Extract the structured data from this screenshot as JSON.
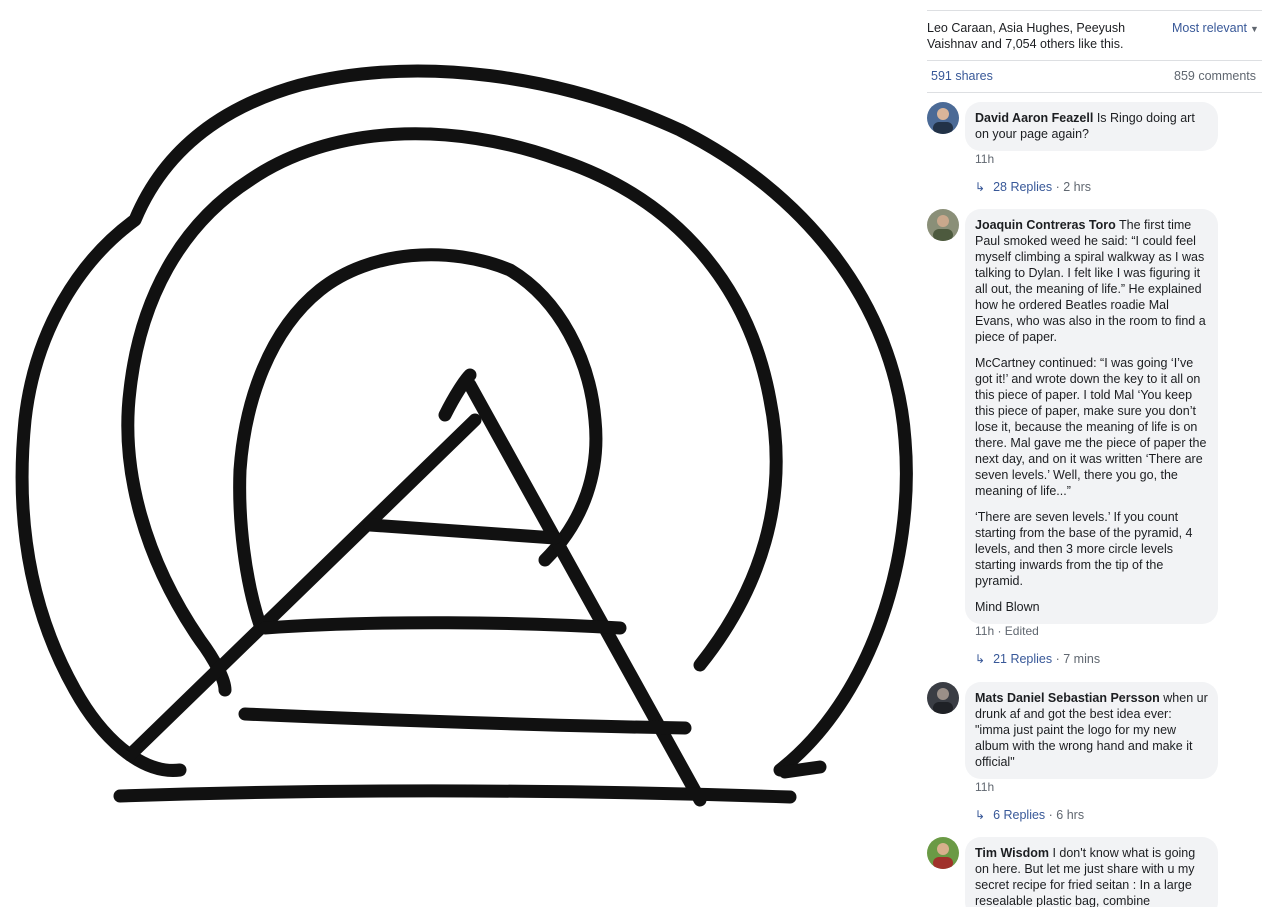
{
  "post": {
    "likes_text": "Leo Caraan, Asia Hughes, Peeyush Vaishnav and 7,054 others like this.",
    "sort_label": "Most relevant",
    "shares": "591 shares",
    "comments_count": "859 comments"
  },
  "comments": [
    {
      "author": "David Aaron Feazell",
      "paragraphs": [
        "Is Ringo doing art on your page again?"
      ],
      "meta": "11h",
      "replies": "28 Replies",
      "replies_time": "· 2 hrs",
      "avatar_color": "#5b6f8f"
    },
    {
      "author": "Joaquin Contreras Toro",
      "paragraphs": [
        "The first time Paul smoked weed he said: “I could feel myself climbing a spiral walkway as I was talking to Dylan. I felt like I was figuring it all out, the meaning of life.” He explained how he ordered Beatles roadie Mal Evans, who was also in the room to find a piece of paper.",
        "McCartney continued: “I was going ‘I’ve got it!’ and wrote down the key to it all on this piece of paper. I told Mal ‘You keep this piece of paper, make sure you don’t lose it, because the meaning of life is on there. Mal gave me the piece of paper the next day, and on it was written ‘There are seven levels.’ Well, there you go, the meaning of life...”",
        "‘There are seven levels.’ If you count starting from the base of the pyramid, 4 levels, and then 3 more circle levels starting inwards from the tip of the pyramid.",
        "Mind Blown"
      ],
      "meta": "11h · Edited",
      "replies": "21 Replies",
      "replies_time": "· 7 mins",
      "avatar_color": "#7a7f6a"
    },
    {
      "author": "Mats Daniel Sebastian Persson",
      "paragraphs": [
        "when ur drunk af and got the best idea ever: \"imma just paint the logo for my new album with the wrong hand and make it official\""
      ],
      "meta": "11h",
      "replies": "6 Replies",
      "replies_time": "· 6 hrs",
      "avatar_color": "#3a3d44"
    },
    {
      "author": "Tim Wisdom",
      "paragraphs": [
        "I don't know what is going on here. But let me just share with u my secret recipe for fried seitan : In a large resealable plastic bag, combine"
      ],
      "avatar_color": "#5d8a3c"
    }
  ]
}
